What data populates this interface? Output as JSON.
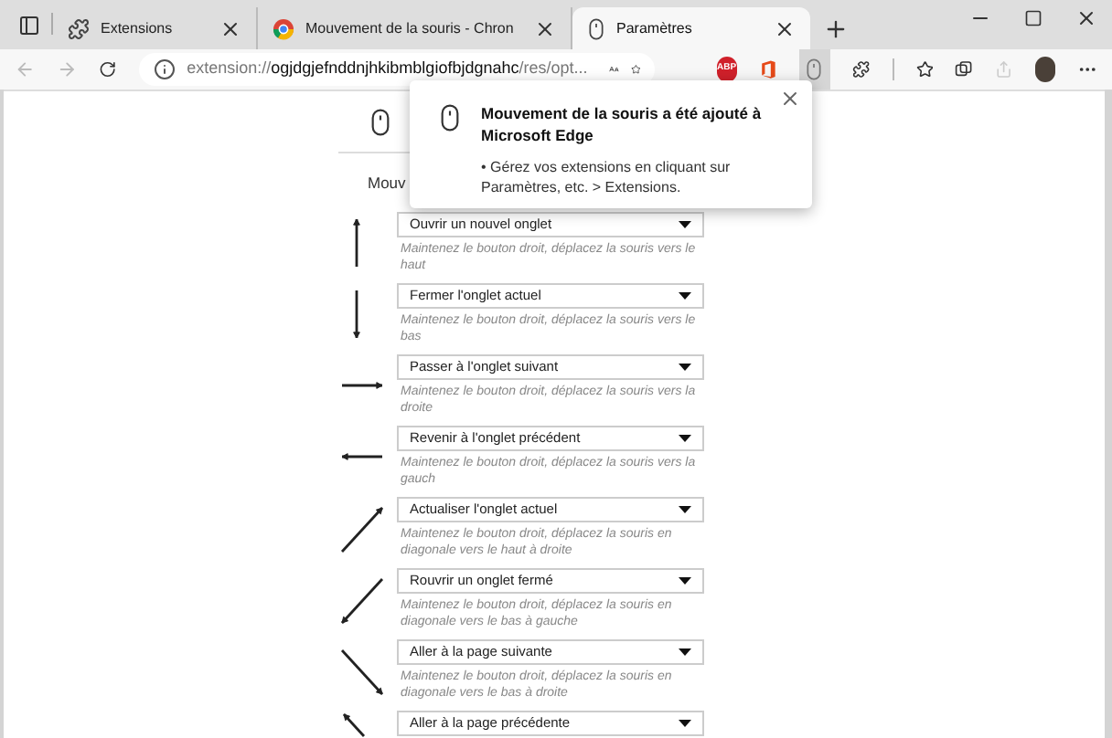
{
  "tabs": [
    {
      "kind": "puzzle",
      "title": "Extensions",
      "selected": false
    },
    {
      "kind": "chrome",
      "title": "Mouvement de la souris - Chron",
      "selected": false
    },
    {
      "kind": "mouse",
      "title": "Paramètres",
      "selected": true
    }
  ],
  "address": {
    "scheme": "extension://",
    "host": "ogjdgjefnddnjhkibmblgiofbjdgnahc",
    "path": "/res/opt..."
  },
  "toolbar": {
    "adblock_badge": "ABP",
    "mouse_extension_pressed": true
  },
  "page": {
    "heading": "Mouv",
    "gestures": [
      {
        "kind": "up",
        "action": "Ouvrir un nouvel onglet",
        "hint": "Maintenez le bouton droit, déplacez la souris vers le haut"
      },
      {
        "kind": "down",
        "action": "Fermer l'onglet actuel",
        "hint": "Maintenez le bouton droit, déplacez la souris vers le bas"
      },
      {
        "kind": "right",
        "action": "Passer à l'onglet suivant",
        "hint": "Maintenez le bouton droit, déplacez la souris vers la droite"
      },
      {
        "kind": "left",
        "action": "Revenir à l'onglet précédent",
        "hint": "Maintenez le bouton droit, déplacez la souris vers la gauch"
      },
      {
        "kind": "up-right",
        "action": "Actualiser l'onglet actuel",
        "hint": "Maintenez le bouton droit, déplacez la souris en diagonale vers le haut à droite"
      },
      {
        "kind": "down-left",
        "action": "Rouvrir un onglet fermé",
        "hint": "Maintenez le bouton droit, déplacez la souris en diagonale vers le bas à gauche"
      },
      {
        "kind": "down-right",
        "action": "Aller à la page suivante",
        "hint": "Maintenez le bouton droit, déplacez la souris en diagonale vers le bas à droite"
      },
      {
        "kind": "up-left",
        "action": "Aller à la page précédente"
      }
    ]
  },
  "popup": {
    "title": "Mouvement de la souris a été ajouté à Microsoft Edge",
    "body": "• Gérez vos extensions en cliquant sur Paramètres, etc. > Extensions."
  }
}
